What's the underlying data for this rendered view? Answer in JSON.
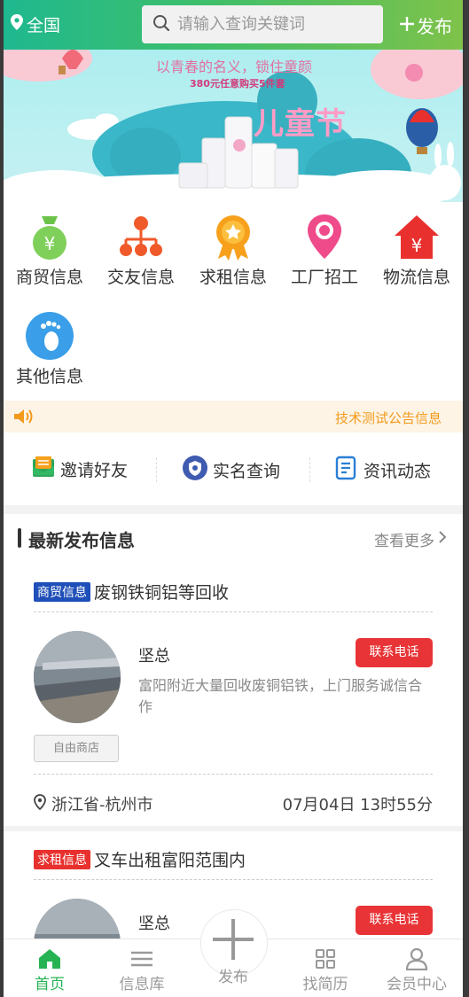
{
  "header": {
    "location": "全国",
    "search_placeholder": "请输入查询关键词",
    "publish_label": "发布"
  },
  "banner": {
    "slogan": "以青春的名义，锁住童颜",
    "promo": "380元任意购买5件套",
    "brand": "儿童节"
  },
  "categories": [
    {
      "label": "商贸信息",
      "icon": "money-bag-icon",
      "color": "#6cc34a"
    },
    {
      "label": "交友信息",
      "icon": "network-icon",
      "color": "#f05a2a"
    },
    {
      "label": "求租信息",
      "icon": "medal-icon",
      "color": "#f7a01c"
    },
    {
      "label": "工厂招工",
      "icon": "location-pin-icon",
      "color": "#ef4a8a"
    },
    {
      "label": "物流信息",
      "icon": "house-yuan-icon",
      "color": "#e8312e"
    },
    {
      "label": "其他信息",
      "icon": "footprint-icon",
      "color": "#3a9ee8"
    }
  ],
  "notice": {
    "text": "技术测试公告信息"
  },
  "quick_links": [
    {
      "label": "邀请好友",
      "icon": "envelope-icon"
    },
    {
      "label": "实名查询",
      "icon": "id-shield-icon"
    },
    {
      "label": "资讯动态",
      "icon": "document-icon"
    }
  ],
  "latest": {
    "title": "最新发布信息",
    "more": "查看更多",
    "posts": [
      {
        "tag": "商贸信息",
        "tag_color": "#1f4fb8",
        "title": "废钢铁铜铝等回收",
        "name": "坚总",
        "call_label": "联系电话",
        "desc": "富阳附近大量回收废铜铝铁，上门服务诚信合作",
        "shop": "自由商店",
        "location": "浙江省-杭州市",
        "time": "07月04日 13时55分"
      },
      {
        "tag": "求租信息",
        "tag_color": "#e8312e",
        "title": "叉车出租富阳范围内",
        "name": "坚总",
        "call_label": "联系电话"
      }
    ]
  },
  "tabbar": [
    {
      "label": "首页",
      "icon": "home-icon",
      "active": true
    },
    {
      "label": "信息库",
      "icon": "menu-icon",
      "active": false
    },
    {
      "label": "发布",
      "icon": "plus-icon",
      "active": false
    },
    {
      "label": "找简历",
      "icon": "grid-icon",
      "active": false
    },
    {
      "label": "会员中心",
      "icon": "user-icon",
      "active": false
    }
  ]
}
